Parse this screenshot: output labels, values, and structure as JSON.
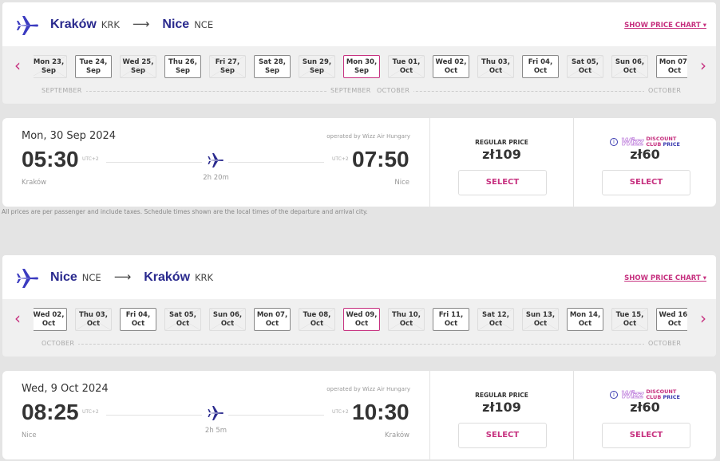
{
  "colors": {
    "brand": "#2a2a8e",
    "accent": "#c6307f"
  },
  "legs": [
    {
      "from_city": "Kraków",
      "from_code": "KRK",
      "to_city": "Nice",
      "to_code": "NCE",
      "arrow": "⟶",
      "show_chart": "SHOW PRICE CHART ▾",
      "dates": [
        {
          "l1": "Mon 23,",
          "l2": "Sep",
          "state": "na"
        },
        {
          "l1": "Tue 24,",
          "l2": "Sep",
          "state": "av"
        },
        {
          "l1": "Wed 25,",
          "l2": "Sep",
          "state": "na"
        },
        {
          "l1": "Thu 26,",
          "l2": "Sep",
          "state": "av"
        },
        {
          "l1": "Fri 27,",
          "l2": "Sep",
          "state": "na"
        },
        {
          "l1": "Sat 28,",
          "l2": "Sep",
          "state": "av"
        },
        {
          "l1": "Sun 29,",
          "l2": "Sep",
          "state": "na"
        },
        {
          "l1": "Mon 30,",
          "l2": "Sep",
          "state": "sel"
        },
        {
          "l1": "Tue 01,",
          "l2": "Oct",
          "state": "na"
        },
        {
          "l1": "Wed 02,",
          "l2": "Oct",
          "state": "av"
        },
        {
          "l1": "Thu 03,",
          "l2": "Oct",
          "state": "na"
        },
        {
          "l1": "Fri 04,",
          "l2": "Oct",
          "state": "av"
        },
        {
          "l1": "Sat 05,",
          "l2": "Oct",
          "state": "na"
        },
        {
          "l1": "Sun 06,",
          "l2": "Oct",
          "state": "na"
        },
        {
          "l1": "Mon 07,",
          "l2": "Oct",
          "state": "av"
        }
      ],
      "months": [
        "SEPTEMBER",
        "SEPTEMBER",
        "OCTOBER",
        "OCTOBER"
      ],
      "flight": {
        "date": "Mon, 30 Sep 2024",
        "operator": "operated by Wizz Air Hungary",
        "dep_time": "05:30",
        "dep_tz": "UTC+2",
        "arr_time": "07:50",
        "arr_tz": "UTC+2",
        "duration": "2h 20m",
        "dep_airport": "Kraków",
        "arr_airport": "Nice"
      },
      "regular_label": "REGULAR PRICE",
      "regular_price": "zł109",
      "wdc_logo": "Wizz",
      "wdc_l1": "DISCOUNT",
      "wdc_l2a": "CLUB",
      "wdc_l2b": "PRICE",
      "wdc_price": "zł60",
      "select": "SELECT"
    },
    {
      "from_city": "Nice",
      "from_code": "NCE",
      "to_city": "Kraków",
      "to_code": "KRK",
      "arrow": "⟶",
      "show_chart": "SHOW PRICE CHART ▾",
      "dates": [
        {
          "l1": "Wed 02,",
          "l2": "Oct",
          "state": "av"
        },
        {
          "l1": "Thu 03,",
          "l2": "Oct",
          "state": "na"
        },
        {
          "l1": "Fri 04,",
          "l2": "Oct",
          "state": "av"
        },
        {
          "l1": "Sat 05,",
          "l2": "Oct",
          "state": "na"
        },
        {
          "l1": "Sun 06,",
          "l2": "Oct",
          "state": "na"
        },
        {
          "l1": "Mon 07,",
          "l2": "Oct",
          "state": "av"
        },
        {
          "l1": "Tue 08,",
          "l2": "Oct",
          "state": "na"
        },
        {
          "l1": "Wed 09,",
          "l2": "Oct",
          "state": "sel"
        },
        {
          "l1": "Thu 10,",
          "l2": "Oct",
          "state": "na"
        },
        {
          "l1": "Fri 11,",
          "l2": "Oct",
          "state": "av"
        },
        {
          "l1": "Sat 12,",
          "l2": "Oct",
          "state": "na"
        },
        {
          "l1": "Sun 13,",
          "l2": "Oct",
          "state": "na"
        },
        {
          "l1": "Mon 14,",
          "l2": "Oct",
          "state": "av"
        },
        {
          "l1": "Tue 15,",
          "l2": "Oct",
          "state": "na"
        },
        {
          "l1": "Wed 16,",
          "l2": "Oct",
          "state": "av"
        }
      ],
      "months": [
        "OCTOBER",
        "OCTOBER"
      ],
      "flight": {
        "date": "Wed, 9 Oct 2024",
        "operator": "operated by Wizz Air Hungary",
        "dep_time": "08:25",
        "dep_tz": "UTC+2",
        "arr_time": "10:30",
        "arr_tz": "UTC+2",
        "duration": "2h 5m",
        "dep_airport": "Nice",
        "arr_airport": "Kraków"
      },
      "regular_label": "REGULAR PRICE",
      "regular_price": "zł109",
      "wdc_logo": "Wizz",
      "wdc_l1": "DISCOUNT",
      "wdc_l2a": "CLUB",
      "wdc_l2b": "PRICE",
      "wdc_price": "zł60",
      "select": "SELECT"
    }
  ],
  "disclaimer": "All prices are per passenger and include taxes. Schedule times shown are the local times of the departure and arrival city."
}
